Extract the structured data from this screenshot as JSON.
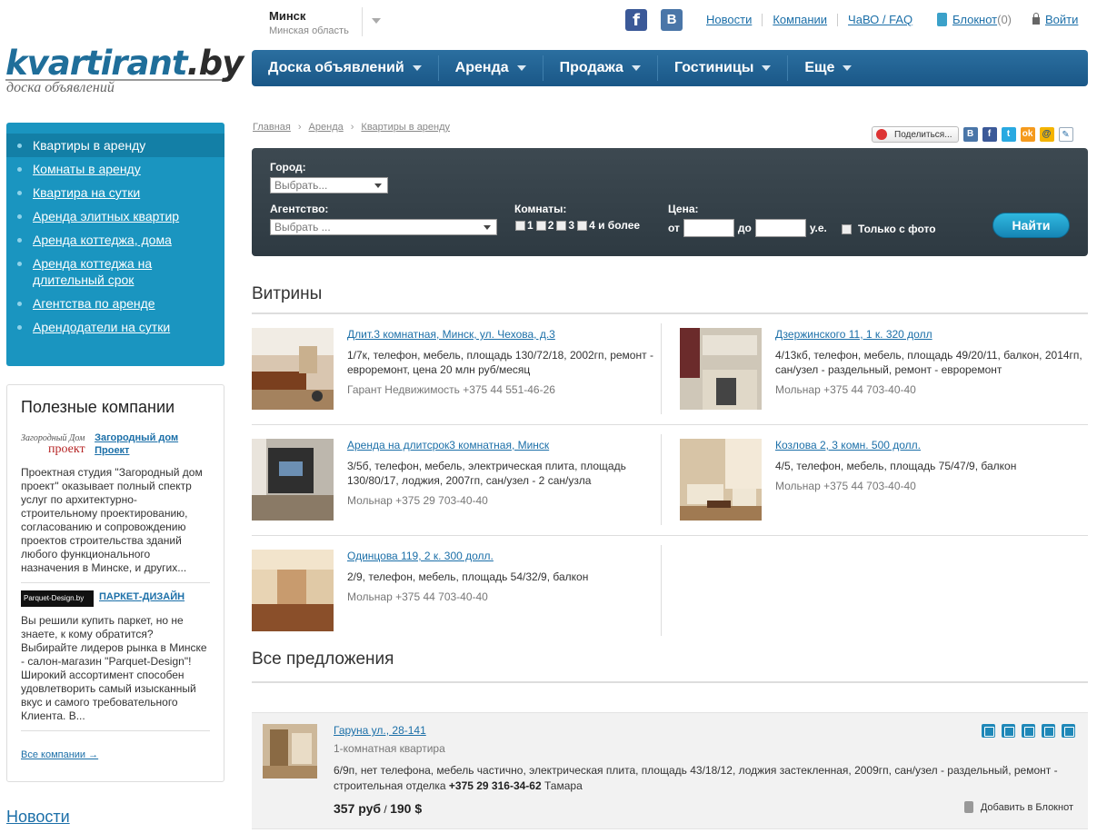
{
  "header": {
    "logo_main": "kvartirant",
    "logo_domain": ".by",
    "logo_sub": "доска объявлений",
    "city": "Минск",
    "region": "Минская область",
    "social": {
      "fb": "f",
      "vk": "B"
    },
    "top_links": [
      "Новости",
      "Компании",
      "ЧаВО / FAQ"
    ],
    "notepad_label": "Блокнот",
    "notepad_count": "(0)",
    "login_label": "Войти"
  },
  "mainnav": [
    "Доска объявлений",
    "Аренда",
    "Продажа",
    "Гостиницы",
    "Еще"
  ],
  "sidebar": {
    "items": [
      "Квартиры в аренду",
      "Комнаты в аренду",
      "Квартира на сутки",
      "Аренда элитных квартир",
      "Аренда коттеджа, дома",
      "Аренда коттеджа на длительный срок",
      "Агентства по аренде",
      "Арендодатели на сутки"
    ],
    "companies_title": "Полезные компании",
    "companies": [
      {
        "logo_line1": "Загородный Дом",
        "logo_line2": "проект",
        "name": "Загородный дом Проект",
        "text": "Проектная студия \"Загородный дом проект\" оказывает полный спектр услуг по архитектурно-строительному проектированию, согласованию и сопровождению проектов строительства зданий любого функционального назначения в Минске, и других..."
      },
      {
        "logo_line1": "Parquet-Design.by",
        "name": "ПАРКЕТ-ДИЗАЙН",
        "text": "Вы решили купить паркет, но не знаете, к кому обратится? Выбирайте лидеров рынка в Минске - салон-магазин \"Parquet-Design\"! Широкий ассортимент способен удовлетворить самый изысканный вкус и самого требовательного Клиента. В..."
      }
    ],
    "all_companies": "Все компании →",
    "news_link": "Новости"
  },
  "breadcrumb": [
    "Главная",
    "Аренда",
    "Квартиры в аренду"
  ],
  "breadcrumb_sep": "›",
  "share": {
    "label": "Поделиться...",
    "icons": [
      "В",
      "f",
      "t",
      "ok",
      "@",
      "✎"
    ]
  },
  "search": {
    "city_label": "Город:",
    "city_placeholder": "Выбрать...",
    "agency_label": "Агентство:",
    "agency_placeholder": "Выбрать ...",
    "rooms_label": "Комнаты:",
    "rooms": [
      "1",
      "2",
      "3",
      "4 и более"
    ],
    "price_label": "Цена:",
    "price_from": "от",
    "price_to": "до",
    "price_unit": "у.е.",
    "photo_only": "Только с фото",
    "submit": "Найти"
  },
  "vitriny_title": "Витрины",
  "vitriny": [
    {
      "title": "Длит.3 комнатная, Минск, ул. Чехова, д.3",
      "desc": "1/7к, телефон, мебель, площадь 130/72/18, 2002гп, ремонт - евроремонт, цена 20 млн руб/месяц",
      "contact": "Гарант Недвижимость +375 44 551-46-26"
    },
    {
      "title": "Дзержинского 11, 1 к. 320 долл",
      "desc": "4/13кб, телефон, мебель, площадь 49/20/11, балкон, 2014гп, сан/узел - раздельный, ремонт - евроремонт",
      "contact": "Мольнар +375 44 703-40-40"
    },
    {
      "title": "Аренда на длитсрок3 комнатная, Минск",
      "desc": "3/5б, телефон, мебель, электрическая плита, площадь 130/80/17, лоджия, 2007гп, сан/узел - 2 сан/узла",
      "contact": "Мольнар +375 29 703-40-40"
    },
    {
      "title": "Козлова 2, 3 комн. 500 долл.",
      "desc": "4/5, телефон, мебель, площадь 75/47/9, балкон",
      "contact": "Мольнар +375 44 703-40-40"
    },
    {
      "title": "Одинцова 119, 2 к. 300 долл.",
      "desc": "2/9, телефон, мебель, площадь 54/32/9, балкон",
      "contact": "Мольнар +375 44 703-40-40"
    }
  ],
  "offers_title": "Все предложения",
  "offer": {
    "title": "Гаруна ул., 28-141",
    "type": "1-комнатная квартира",
    "desc": "6/9п, нет телефона, мебель частично, электрическая плита, площадь 43/18/12, лоджия застекленная, 2009гп, сан/узел - раздельный, ремонт - строительная отделка",
    "phone": "+375 29 316-34-62",
    "owner": "Тамара",
    "price_byn": "357 руб",
    "price_sep": " / ",
    "price_usd": "190 $",
    "add_to_notepad": "Добавить в Блокнот"
  },
  "colors": {
    "brand_blue": "#1f6e9a",
    "nav_blue": "#1a5787",
    "sidebar_blue": "#1a95c0",
    "search_bg": "#2e3a42",
    "button_blue": "#1685b5",
    "link": "#1b6fa8"
  }
}
